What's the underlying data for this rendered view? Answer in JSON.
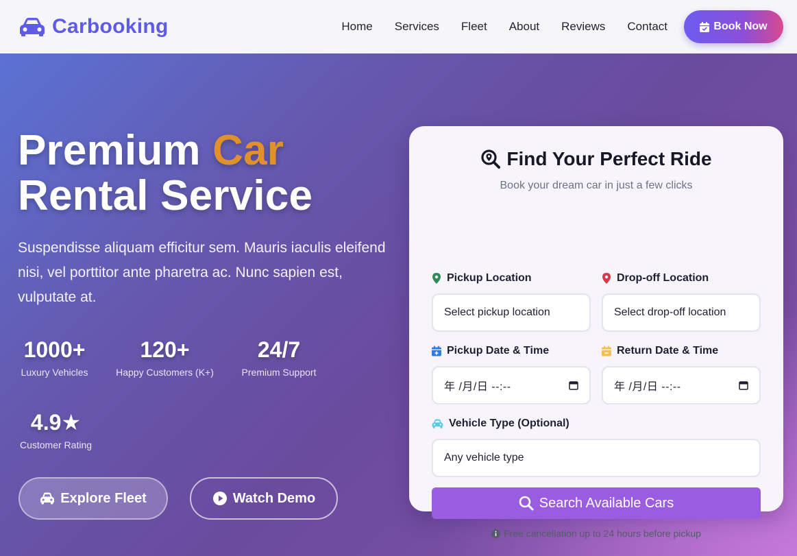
{
  "brand": {
    "name": "Carbooking"
  },
  "nav": {
    "links": [
      "Home",
      "Services",
      "Fleet",
      "About",
      "Reviews",
      "Contact"
    ],
    "cta": "Book Now"
  },
  "hero": {
    "title_part1": "Premium ",
    "title_accent": "Car",
    "title_line2": "Rental Service",
    "description": "Suspendisse aliquam efficitur sem. Mauris iaculis eleifend nisi, vel porttitor ante pharetra ac. Nunc sapien est, vulputate at.",
    "stats": [
      {
        "value": "1000+",
        "label": "Luxury Vehicles"
      },
      {
        "value": "120+",
        "label": "Happy Customers (K+)"
      },
      {
        "value": "24/7",
        "label": "Premium Support"
      },
      {
        "value": "4.9★",
        "label": "Customer Rating"
      }
    ],
    "buttons": {
      "explore": "Explore Fleet",
      "demo": "Watch Demo"
    }
  },
  "booking": {
    "title": "Find Your Perfect Ride",
    "subtitle": "Book your dream car in just a few clicks",
    "pickup_label": "Pickup Location",
    "pickup_value": "Select pickup location",
    "dropoff_label": "Drop-off Location",
    "dropoff_value": "Select drop-off location",
    "pickup_date_label": "Pickup Date & Time",
    "pickup_date_value": "年 /月/日 --:--",
    "return_date_label": "Return Date & Time",
    "return_date_value": "年 /月/日 --:--",
    "vehicle_label": "Vehicle Type (Optional)",
    "vehicle_value": "Any vehicle type",
    "search_button": "Search Available Cars",
    "note": "Free cancellation up to 24 hours before pickup"
  },
  "colors": {
    "brand": "#5e5ce6",
    "accent": "#e0912e",
    "search_button": "#9a5de0",
    "pin_pickup": "#2e8b57",
    "pin_dropoff": "#d93a4a",
    "cal_pickup": "#2f7de1",
    "cal_return": "#f2c14e",
    "car_icon": "#5bc8e6"
  }
}
